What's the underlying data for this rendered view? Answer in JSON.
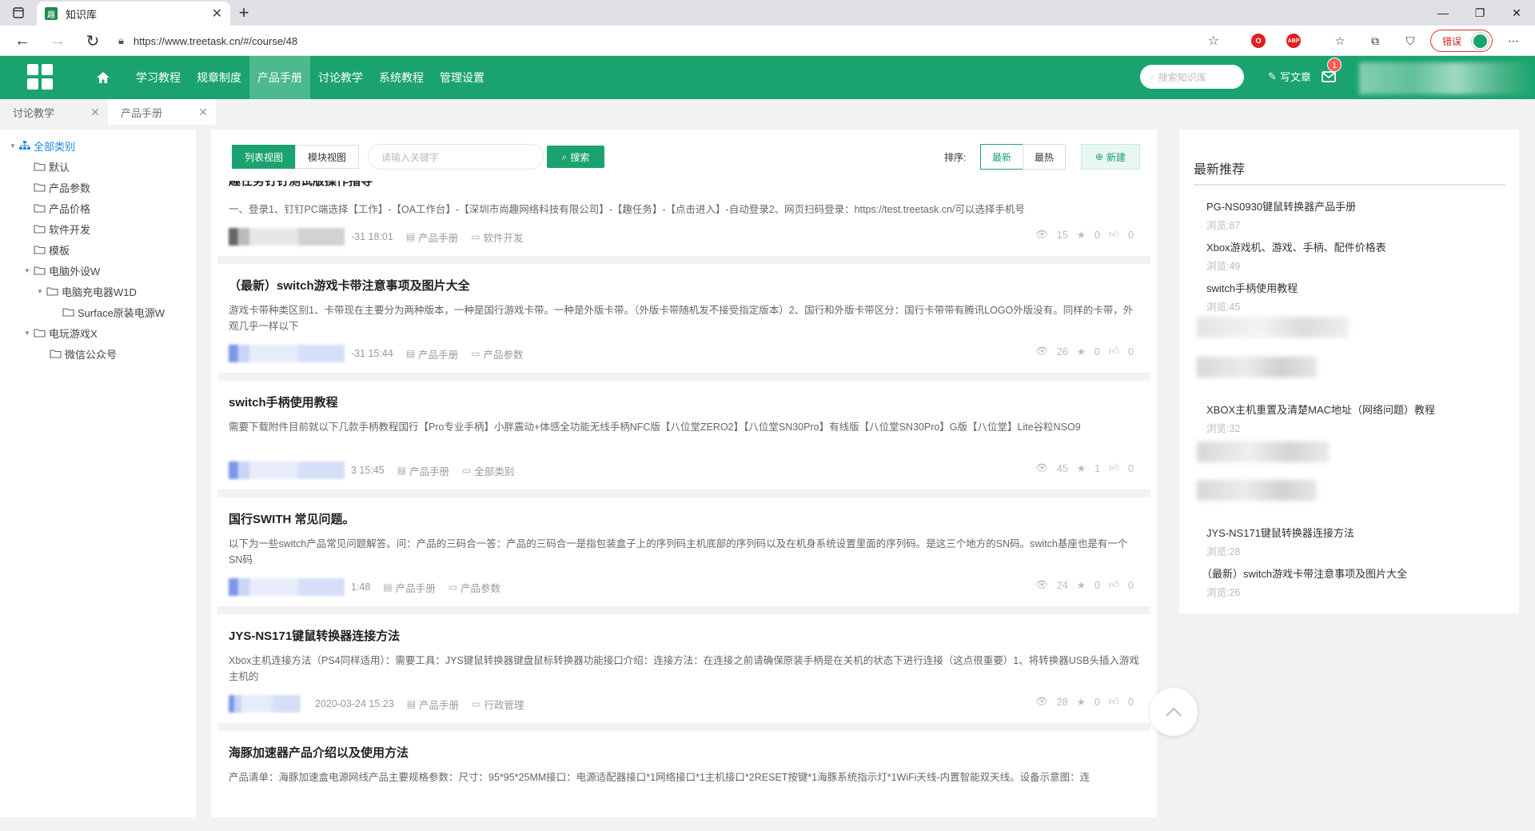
{
  "browser": {
    "tab_title": "知识库",
    "favicon_text": "趣",
    "url": "https://www.treetask.cn/#/course/48",
    "profile_label": "错误"
  },
  "header": {
    "nav": [
      "学习教程",
      "规章制度",
      "产品手册",
      "讨论教学",
      "系统教程",
      "管理设置"
    ],
    "active_nav": "产品手册",
    "search_placeholder": "搜索知识库",
    "write_label": "写文章",
    "mail_badge": "1"
  },
  "page_tabs": [
    "讨论教学",
    "产品手册"
  ],
  "tree": {
    "root": "全部类别",
    "items": [
      {
        "label": "默认"
      },
      {
        "label": "产品参数"
      },
      {
        "label": "产品价格"
      },
      {
        "label": "软件开发"
      },
      {
        "label": "模板"
      },
      {
        "label": "电脑外设W"
      },
      {
        "label": "电脑充电器W1D"
      },
      {
        "label": "Surface原装电源W"
      },
      {
        "label": "电玩游戏X"
      },
      {
        "label": "微信公众号"
      }
    ]
  },
  "toolbar": {
    "list_view": "列表视图",
    "block_view": "模块视图",
    "keyword_placeholder": "请输入关键字",
    "search": "搜索",
    "sort_label": "排序:",
    "sort_newest": "最新",
    "sort_hottest": "最热",
    "new": "新建"
  },
  "articles": [
    {
      "title": "趣任务钉钉测试版操作指导",
      "summary": "一、登录1、钉钉PC端选择【工作】-【OA工作台】-【深圳市尚趣网络科技有限公司】-【趣任务】-【点击进入】-自动登录2、网页扫码登录：https://test.treetask.cn/可以选择手机号",
      "date": "-31 18:01",
      "category": "产品手册",
      "folder": "软件开发",
      "views": "15",
      "stars": "0",
      "likes": "0"
    },
    {
      "title": "（最新）switch游戏卡带注意事项及图片大全",
      "summary": "游戏卡带种类区别1、卡带现在主要分为两种版本，一种是国行游戏卡带。一种是外版卡带。（外版卡带随机发不接受指定版本）2、国行和外版卡带区分：国行卡带带有腾讯LOGO外版没有。同样的卡带，外观几乎一样以下",
      "date": "-31 15:44",
      "category": "产品手册",
      "folder": "产品参数",
      "views": "26",
      "stars": "0",
      "likes": "0"
    },
    {
      "title": "switch手柄使用教程",
      "summary": "需要下载附件目前就以下几款手柄教程国行【Pro专业手柄】小胖震动+体感全功能无线手柄NFC版【八位堂ZERO2】【八位堂SN30Pro】有线版【八位堂SN30Pro】G版【八位堂】Lite谷粒NSO9",
      "date": "3 15:45",
      "category": "产品手册",
      "folder": "全部类别",
      "views": "45",
      "stars": "1",
      "likes": "0"
    },
    {
      "title": "国行SWITH 常见问题。",
      "summary": "以下为一些switch产品常见问题解答。问：产品的三码合一答：产品的三码合一是指包装盒子上的序列码主机底部的序列码以及在机身系统设置里面的序列码。是这三个地方的SN码。switch基座也是有一个SN码",
      "date": "1:48",
      "category": "产品手册",
      "folder": "产品参数",
      "views": "24",
      "stars": "0",
      "likes": "0"
    },
    {
      "title": "JYS-NS171键鼠转换器连接方法",
      "summary": "Xbox主机连接方法（PS4同样适用）：需要工具：JYS键鼠转换器键盘鼠标转换器功能接口介绍：连接方法：在连接之前请确保原装手柄是在关机的状态下进行连接（这点很重要）1、将转换器USB头插入游戏主机的",
      "date": "2020-03-24 15:23",
      "category": "产品手册",
      "folder": "行政管理",
      "views": "28",
      "stars": "0",
      "likes": "0"
    },
    {
      "title": "海豚加速器产品介绍以及使用方法",
      "summary": "产品清单：海豚加速盒电源网线产品主要规格参数：尺寸：95*95*25MM接口：电源适配器接口*1网络接口*1主机接口*2RESET按键*1海豚系统指示灯*1WiFi天线-内置智能双天线。设备示意图：连",
      "date": "",
      "category": "",
      "folder": "",
      "views": "",
      "stars": "",
      "likes": ""
    }
  ],
  "right_panel": {
    "title": "最新推荐",
    "items": [
      {
        "title": "PG-NS0930键鼠转换器产品手册",
        "views": "浏览:87"
      },
      {
        "title": "Xbox游戏机、游戏、手柄、配件价格表",
        "views": "浏览:49"
      },
      {
        "title": "switch手柄使用教程",
        "views": "浏览:45"
      },
      {
        "title": "XBOX主机重置及清楚MAC地址（网络问题）教程",
        "views": "浏览:32"
      },
      {
        "title": "JYS-NS171键鼠转换器连接方法",
        "views": "浏览:28"
      },
      {
        "title": "（最新）switch游戏卡带注意事项及图片大全",
        "views": "浏览:26"
      }
    ]
  },
  "colors": {
    "brand": "#1aa36f",
    "tree_root": "#1e88e5",
    "badge": "#ff5a5a"
  }
}
